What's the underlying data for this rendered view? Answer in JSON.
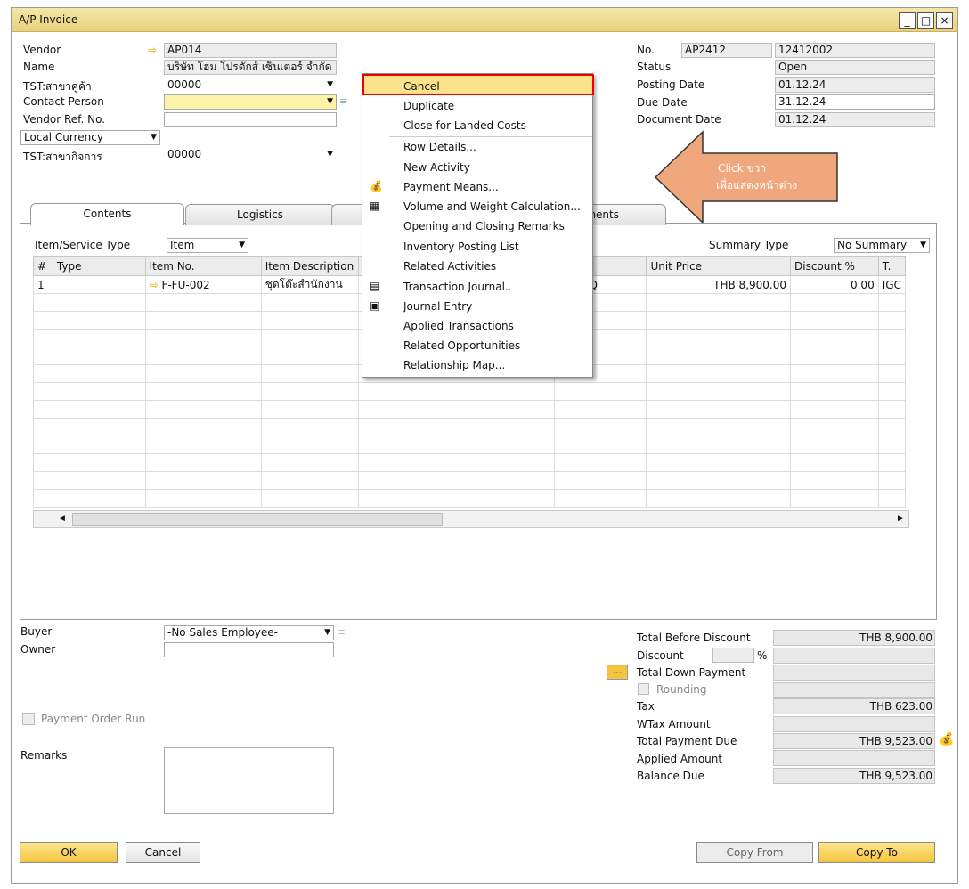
{
  "window": {
    "title": "A/P Invoice"
  },
  "header_left": {
    "vendor_label": "Vendor",
    "vendor_value": "AP014",
    "name_label": "Name",
    "name_value": "บริษัท โฮม โปรดักส์ เซ็นเตอร์ จำกัด",
    "branch_label": "TST:สาขาคู่ค้า",
    "branch_value": "00000",
    "contact_label": "Contact Person",
    "contact_value": "",
    "vendor_ref_label": "Vendor Ref. No.",
    "vendor_ref_value": "",
    "currency_value": "Local Currency",
    "biz_branch_label": "TST:สาขากิจการ",
    "biz_branch_value": "00000"
  },
  "header_right": {
    "no_label": "No.",
    "series": "AP2412",
    "number": "12412002",
    "status_label": "Status",
    "status_value": "Open",
    "posting_label": "Posting Date",
    "posting_value": "01.12.24",
    "due_label": "Due Date",
    "due_value": "31.12.24",
    "doc_label": "Document Date",
    "doc_value": "01.12.24"
  },
  "tabs": [
    {
      "label": "Contents"
    },
    {
      "label": "Logistics"
    },
    {
      "label": "nents"
    }
  ],
  "contents": {
    "item_type_label": "Item/Service Type",
    "item_type_value": "Item",
    "summary_label": "Summary Type",
    "summary_value": "No Summary",
    "columns": [
      "#",
      "Type",
      "Item No.",
      "Item Description",
      "",
      "",
      "e",
      "Unit Price",
      "Discount %",
      "T."
    ],
    "row": {
      "num": "1",
      "type": "",
      "item_no": "F-FU-002",
      "desc": "ชุดโต๊ะสำนักงาน",
      "wh": "WH-HQ",
      "unit_price": "THB 8,900.00",
      "discount": "0.00",
      "tax": "IGC"
    }
  },
  "context_menu": {
    "items": [
      {
        "label": "Cancel",
        "icon": ""
      },
      {
        "label": "Duplicate",
        "icon": ""
      },
      {
        "label": "Close for Landed Costs",
        "icon": ""
      },
      {
        "label": "Row Details...",
        "icon": ""
      },
      {
        "label": "New Activity",
        "icon": ""
      },
      {
        "label": "Payment Means...",
        "icon": "payment-means-icon"
      },
      {
        "label": "Volume and Weight Calculation...",
        "icon": "volume-weight-icon"
      },
      {
        "label": "Opening and Closing Remarks",
        "icon": ""
      },
      {
        "label": "Inventory Posting List",
        "icon": ""
      },
      {
        "label": "Related Activities",
        "icon": ""
      },
      {
        "label": "Transaction Journal..",
        "icon": "transaction-journal-icon"
      },
      {
        "label": "Journal Entry",
        "icon": "journal-entry-icon"
      },
      {
        "label": "Applied Transactions",
        "icon": ""
      },
      {
        "label": "Related Opportunities",
        "icon": ""
      },
      {
        "label": "Relationship Map...",
        "icon": ""
      }
    ]
  },
  "annotation": {
    "line1": "Click ขวา",
    "line2": "เพื่อแสดงหน้าต่าง",
    "color": "#f0a77e"
  },
  "footer_left": {
    "buyer_label": "Buyer",
    "buyer_value": "-No Sales Employee-",
    "owner_label": "Owner",
    "owner_value": "",
    "payment_order_label": "Payment Order Run",
    "remarks_label": "Remarks",
    "remarks_value": ""
  },
  "totals": {
    "before_discount_label": "Total Before Discount",
    "before_discount_value": "THB 8,900.00",
    "discount_label": "Discount",
    "discount_pct": "%",
    "discount_value": "",
    "down_payment_label": "Total Down Payment",
    "down_payment_value": "",
    "rounding_label": "Rounding",
    "tax_label": "Tax",
    "tax_value": "THB 623.00",
    "wtax_label": "WTax Amount",
    "wtax_value": "",
    "payment_due_label": "Total Payment Due",
    "payment_due_value": "THB 9,523.00",
    "applied_label": "Applied Amount",
    "applied_value": "",
    "balance_label": "Balance Due",
    "balance_value": "THB 9,523.00"
  },
  "buttons": {
    "ok": "OK",
    "cancel": "Cancel",
    "copy_from": "Copy From",
    "copy_to": "Copy To"
  }
}
